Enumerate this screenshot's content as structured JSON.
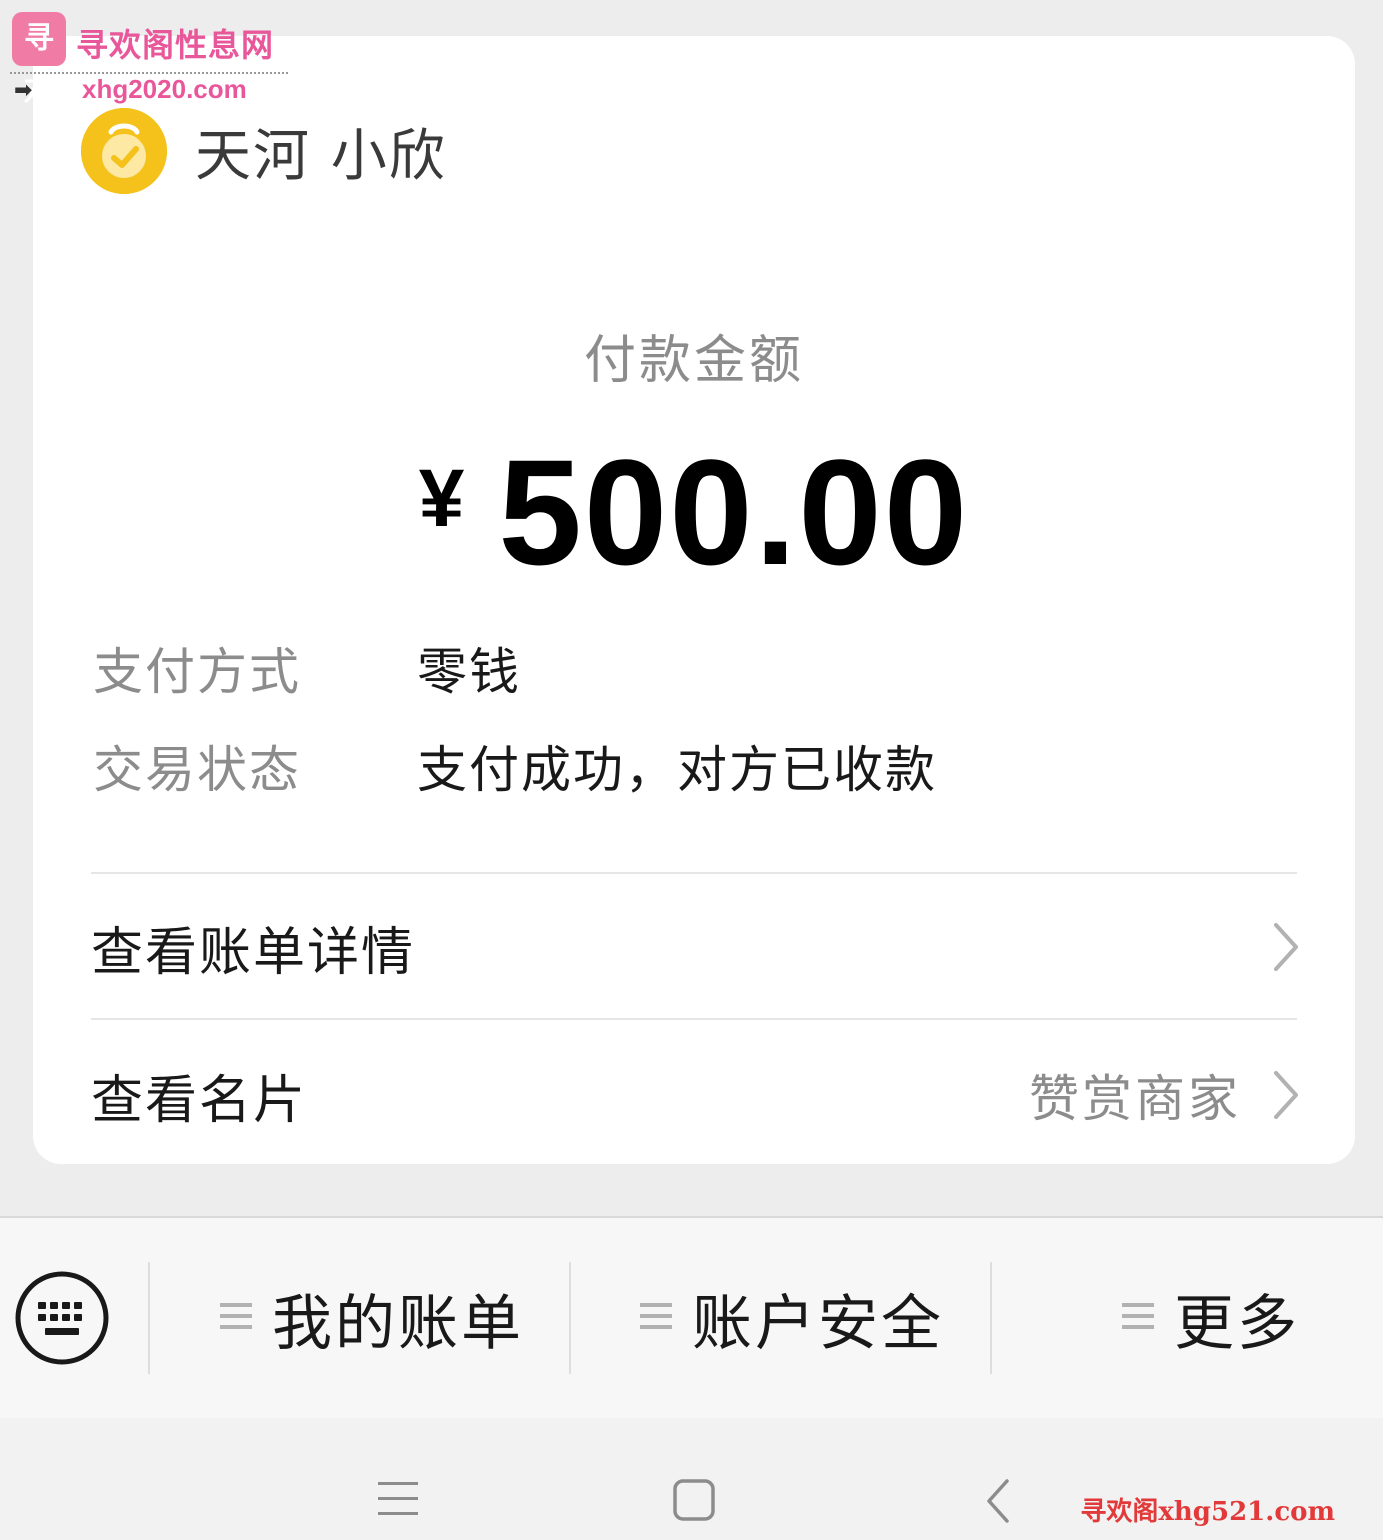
{
  "watermark": {
    "logo_char": "寻欢",
    "site_name": "寻欢阁性息网",
    "arrow": "➡",
    "url": "xhg2020.com",
    "bottom_text": "寻欢阁xhg521.com"
  },
  "merchant": {
    "name": "天河 小欣",
    "avatar_icon": "wechat-pay-merchant-icon",
    "avatar_color": "#f4c21b"
  },
  "payment": {
    "amount_label": "付款金额",
    "currency_symbol": "¥",
    "amount": "500.00"
  },
  "details": [
    {
      "key": "支付方式",
      "value": "零钱"
    },
    {
      "key": "交易状态",
      "value": "支付成功，对方已收款"
    }
  ],
  "links": {
    "bill_detail": {
      "label": "查看账单详情"
    },
    "business_card": {
      "label": "查看名片",
      "note": "赞赏商家"
    }
  },
  "menu_bar": {
    "keyboard_icon": "keyboard-icon",
    "items": [
      {
        "label": "我的账单"
      },
      {
        "label": "账户安全"
      },
      {
        "label": "更多"
      }
    ]
  },
  "system_nav": {
    "menu_icon": "menu-icon",
    "home_icon": "home-icon",
    "back_icon": "back-icon"
  },
  "colors": {
    "page_bg": "#ededed",
    "card_bg": "#ffffff",
    "watermark_pink": "#e9579b",
    "watermark_red": "#e23a3a"
  }
}
